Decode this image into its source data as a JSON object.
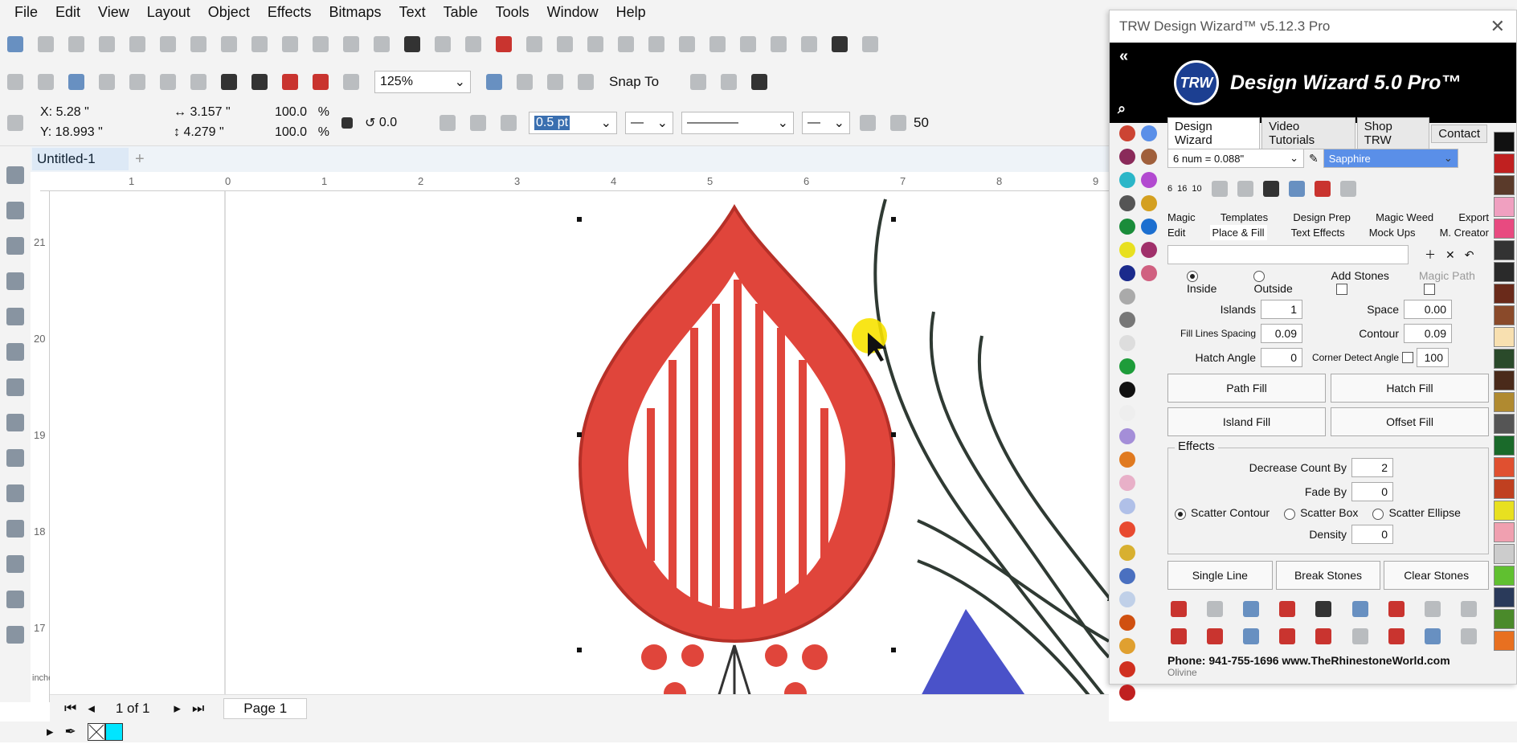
{
  "menu": [
    "File",
    "Edit",
    "View",
    "Layout",
    "Object",
    "Effects",
    "Bitmaps",
    "Text",
    "Table",
    "Tools",
    "Window",
    "Help"
  ],
  "toolbar": {
    "zoom": "125%",
    "snap_to": "Snap To",
    "x": "X: 5.28 \"",
    "y": "Y: 18.993 \"",
    "width": "3.157 \"",
    "height": "4.279 \"",
    "scale_w": "100.0",
    "scale_h": "100.0",
    "percent": "%",
    "rotation": "0.0",
    "outline_width": "0.5 pt",
    "partial": "50"
  },
  "document": {
    "tab": "Untitled-1",
    "page_count": "1 of 1",
    "page_tab": "Page 1",
    "ruler_units": "inches",
    "ruler_top": [
      "1",
      "0",
      "1",
      "2",
      "3",
      "4",
      "5",
      "6",
      "7",
      "8",
      "9"
    ],
    "ruler_left": [
      "21",
      "20",
      "19",
      "18",
      "17"
    ]
  },
  "panel": {
    "title": "TRW Design Wizard™ v5.12.3 Pro",
    "logo_text": "Design Wizard 5.0 Pro™",
    "logo_badge": "TRW",
    "tabs": [
      "Design Wizard",
      "Video Tutorials",
      "Shop TRW",
      "Contact"
    ],
    "stone_size": "6 num = 0.088\"",
    "stone_color": "Sapphire",
    "size_labels": [
      "6",
      "16",
      "10"
    ],
    "nav": [
      "Magic",
      "Templates",
      "Design Prep",
      "Magic Weed",
      "Export",
      "Edit",
      "Place & Fill",
      "Text Effects",
      "Mock Ups",
      "M. Creator"
    ],
    "inside": "Inside",
    "outside": "Outside",
    "add_stones": "Add Stones",
    "magic_path": "Magic Path",
    "islands_label": "Islands",
    "islands": "1",
    "space_label": "Space",
    "space": "0.00",
    "fill_spacing_label": "Fill Lines Spacing",
    "fill_spacing": "0.09",
    "contour_label": "Contour",
    "contour": "0.09",
    "hatch_angle_label": "Hatch Angle",
    "hatch_angle": "0",
    "corner_label": "Corner Detect Angle",
    "corner": "100",
    "buttons": [
      "Path Fill",
      "Hatch Fill",
      "Island Fill",
      "Offset Fill"
    ],
    "effects": "Effects",
    "decrease_label": "Decrease Count By",
    "decrease": "2",
    "fade_label": "Fade By",
    "fade": "0",
    "scatter_contour": "Scatter Contour",
    "scatter_box": "Scatter Box",
    "scatter_ellipse": "Scatter Ellipse",
    "density_label": "Density",
    "density": "0",
    "bottom_buttons": [
      "Single Line",
      "Break Stones",
      "Clear Stones"
    ],
    "phone": "Phone: 941-755-1696  www.TheRhinestoneWorld.com",
    "status": "Olivine"
  },
  "colors": {
    "accent": "#3a6fb0",
    "drop_red": "#e0453b",
    "drop_outline": "#b63028",
    "stone_blue": "#4a52c9",
    "cursor_yellow": "#f7e200"
  }
}
